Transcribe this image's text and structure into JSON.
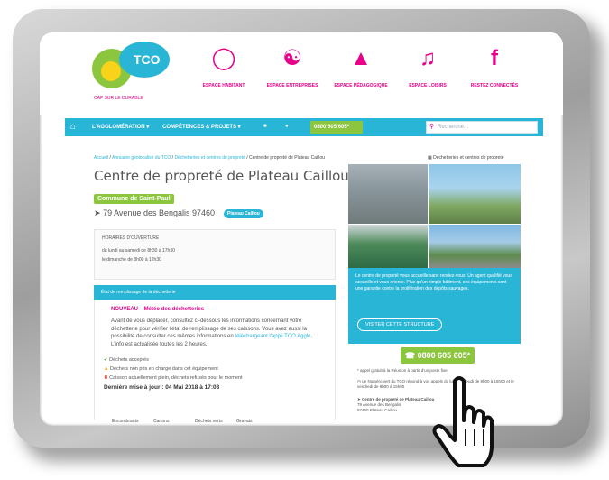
{
  "logo": {
    "name": "TCO",
    "tagline": "CAP SUR LE DURABLE"
  },
  "nav": [
    {
      "label": "ESPACE HABITANT",
      "icon": "user-circle-icon"
    },
    {
      "label": "ESPACE ENTREPRISES",
      "icon": "handshake-icon"
    },
    {
      "label": "ESPACE PÉDAGOGIQUE",
      "icon": "graduation-cap-icon"
    },
    {
      "label": "ESPACE LOISIRS",
      "icon": "music-note-icon"
    },
    {
      "label": "RESTEZ CONNECTÉS",
      "icon": "facebook-icon"
    }
  ],
  "toolbar": {
    "agglomeration": "L'AGGLOMÉRATION ▾",
    "competences": "COMPÉTENCES & PROJETS ▾",
    "phone": "0800 605 605*",
    "search_placeholder": "Recherche..."
  },
  "breadcrumb": {
    "home": "Accueil",
    "annuaire": "Annuaire géolocalisé du TCO",
    "decheteries": "Déchetteries et centres de propreté",
    "current": "Centre de propreté de Plateau Caillou",
    "right": "Déchetteries et centres de propreté"
  },
  "page": {
    "title": "Centre de propreté de Plateau Caillou",
    "commune": "Commune de Saint-Paul",
    "address": "79 Avenue des Bengalis 97460",
    "chip": "Plateau Caillou"
  },
  "hours": {
    "heading": "HORAIRES D'OUVERTURE",
    "line1": "du lundi au samedi de 8h30 à 17h30",
    "line2": "le dimanche de 8h00 à 12h30"
  },
  "meteo": {
    "header": "État de remplissage de la déchetterie",
    "title": "NOUVEAU – Météo des déchetteries",
    "text1": "Avant de vous déplacer, consultez ci-dessous les informations concernant votre déchetterie pour vérifier l'état de remplissage de ses caissons. Vous avez aussi la possibilité de consulter ces mêmes informations en",
    "link": "téléchargeant l'appli TCO Agglo",
    "text2": ". L'info est actualisée toutes les 2 heures.",
    "legend_ok": "Déchets acceptés",
    "legend_partial": "Déchets non pris en charge dans cet équipement",
    "legend_full": "Caisson actuellement plein, déchets refusés pour le moment",
    "updated": "Dernière mise à jour : 04 Mai 2018 à 17:03",
    "cols": [
      "Encombrants",
      "Cartons",
      "Déchets verts",
      "Gravats"
    ]
  },
  "panel": {
    "text": "Le centre de propreté vous accueille sans rendez-vous. Un agent qualifié vous accueille et vous oriente. Plus qu'un simple bâtiment, ces équipements sont une garantie contre la prolifération des dépôts sauvages.",
    "button": "VISITER CETTE STRUCTURE"
  },
  "contact": {
    "phone": "0800 605 605*",
    "note": "* appel gratuit à la Réunion à partir d'un poste fixe",
    "numero": "Le Numéro vert du TCO répond à vos appels du lundi au jeudi de 8h00 à 16h00 et le vendredi de 8h00 à 15h00",
    "addr_title": "Centre de propreté de Plateau Caillou",
    "addr1": "79 Avenue des Bengalis",
    "addr2": "97460 Plateau Caillou"
  }
}
